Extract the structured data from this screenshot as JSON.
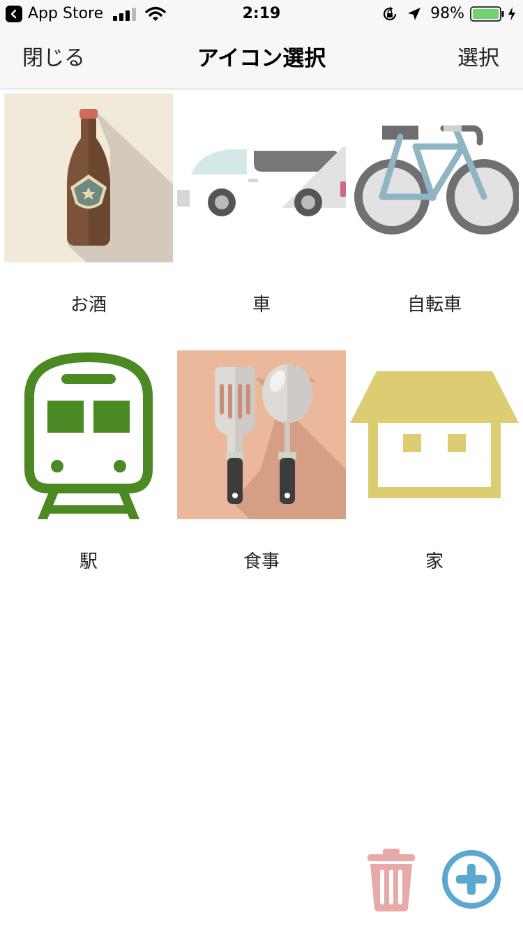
{
  "status_bar": {
    "back_app": "App Store",
    "time": "2:19",
    "battery_percent": "98%"
  },
  "nav": {
    "close_label": "閉じる",
    "title": "アイコン選択",
    "select_label": "選択"
  },
  "icons": [
    {
      "label": "お酒",
      "icon": "beer-bottle-icon"
    },
    {
      "label": "車",
      "icon": "car-icon"
    },
    {
      "label": "自転車",
      "icon": "bicycle-icon"
    },
    {
      "label": "駅",
      "icon": "train-icon"
    },
    {
      "label": "食事",
      "icon": "utensils-icon"
    },
    {
      "label": "家",
      "icon": "house-icon"
    }
  ],
  "toolbar": {
    "trash_icon": "trash-icon",
    "add_icon": "plus-circle-icon"
  },
  "colors": {
    "accent_blue": "#5aa8cf",
    "trash_pink": "#e8a9a9",
    "train_green": "#4b8a22",
    "house_yellow": "#dccc72"
  }
}
